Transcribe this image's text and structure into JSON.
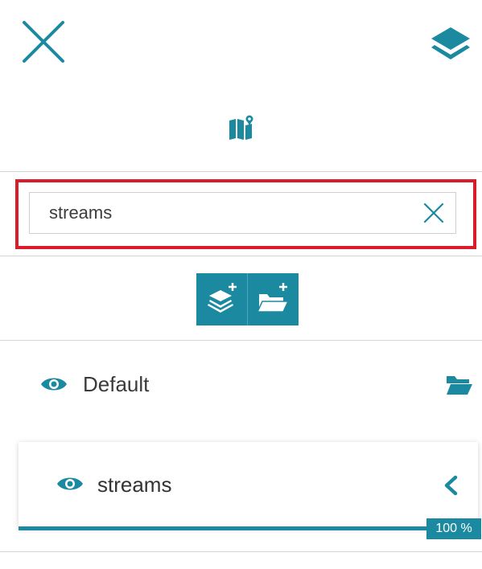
{
  "search": {
    "value": "streams"
  },
  "layer_groups": [
    {
      "label": "Default",
      "layers": [
        {
          "label": "streams",
          "opacity_percent": 100,
          "opacity_label": "100 %"
        }
      ]
    }
  ],
  "colors": {
    "accent": "#1b8aa0",
    "highlight_border": "#d91b2a",
    "text": "#3a3a3a"
  },
  "icons": {
    "close": "close-icon",
    "layers": "layers-icon",
    "map": "map-icon",
    "clear": "clear-search-icon",
    "add_layer": "add-layer-icon",
    "add_group": "add-group-icon",
    "visibility": "eye-icon",
    "folder": "folder-open-icon",
    "collapse": "chevron-left-icon"
  }
}
